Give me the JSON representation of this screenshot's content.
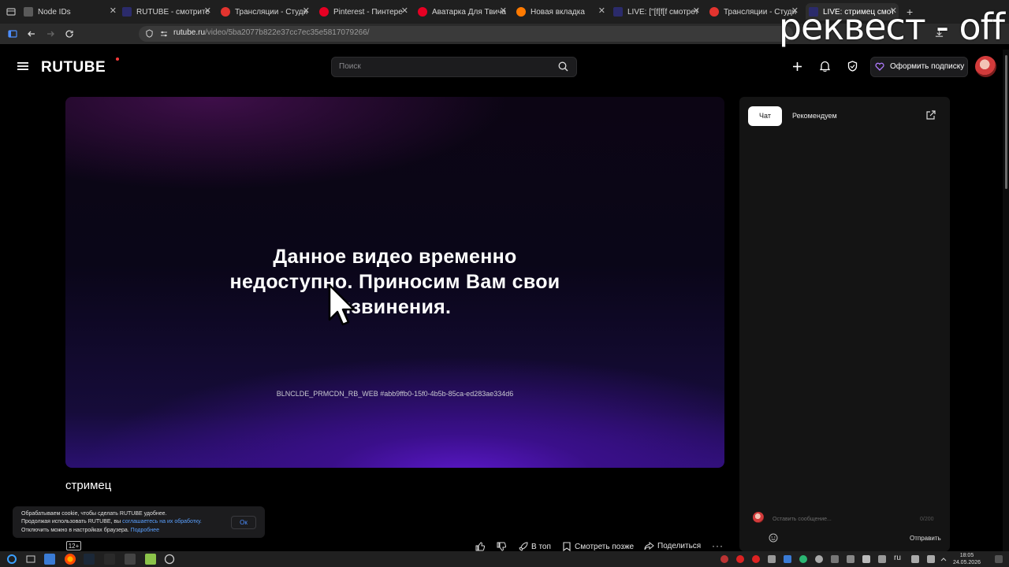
{
  "browser": {
    "tabs": [
      {
        "label": "Node IDs",
        "color": "#5a5a5a"
      },
      {
        "label": "RUTUBE - смотрите",
        "color": "#e3342f"
      },
      {
        "label": "Трансляции - Студи",
        "color": "#e3342f"
      },
      {
        "label": "Pinterest - Пинтере",
        "color": "#e60023"
      },
      {
        "label": "Аватарка Для Твича",
        "color": "#e60023"
      },
      {
        "label": "Новая вкладка",
        "color": "#ff7a00"
      },
      {
        "label": "LIVE: [\"[f[f[f смотрет",
        "color": "#e3342f"
      },
      {
        "label": "Трансляции - Студи",
        "color": "#e3342f"
      },
      {
        "label": "LIVE: стримец смот",
        "color": "#e3342f"
      }
    ],
    "url_domain": "rutube.ru",
    "url_path": "/video/5ba2077b822e37cc7ec35e5817079266/"
  },
  "watermark": "реквест - off",
  "header": {
    "logo": "RUTUBE",
    "search_placeholder": "Поиск",
    "subscribe_label": "Оформить подписку"
  },
  "player": {
    "error_message": "Данное видео временно недоступно. Приносим Вам свои извинения.",
    "error_code": "BLNCLDE_PRMCDN_RB_WEB #abb9ffb0-15f0-4b5b-85ca-ed283ae334d6"
  },
  "video": {
    "title": "стримец",
    "age_rating": "12+"
  },
  "cookie": {
    "line1": "Обрабатываем cookie, чтобы сделать RUTUBE удобнее.",
    "line2_prefix": "Продолжая использовать RUTUBE, вы",
    "line2_link": "соглашаетесь на их обработку.",
    "line3_prefix": "Отключить можно в настройках браузера.",
    "line3_link": "Подробнее",
    "ok_label": "Ок"
  },
  "actions": {
    "top_label": "В топ",
    "watch_later_label": "Смотреть позже",
    "share_label": "Поделиться"
  },
  "sidebar": {
    "tab_chat": "Чат",
    "tab_recommended": "Рекомендуем",
    "chat_placeholder": "Оставить сообщение...",
    "chat_counter": "0/200",
    "send_label": "Отправить"
  },
  "taskbar": {
    "time": "18:05",
    "date": "24.05.2026",
    "lang": "ru"
  }
}
